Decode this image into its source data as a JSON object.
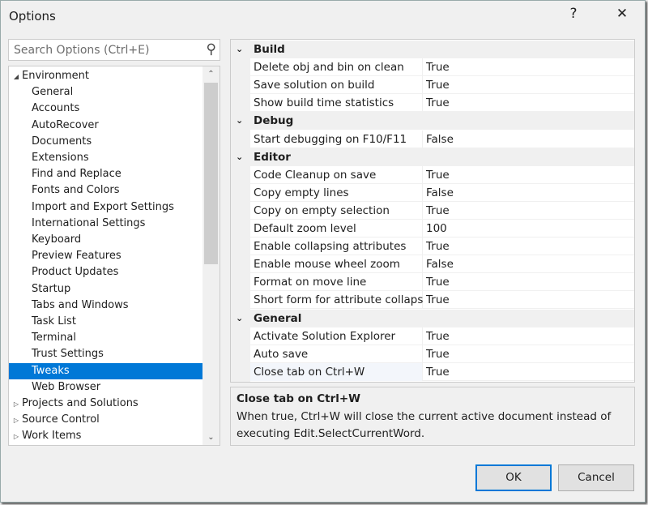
{
  "window": {
    "title": "Options",
    "help_label": "?",
    "close_label": "✕"
  },
  "search": {
    "placeholder": "Search Options (Ctrl+E)",
    "icon": "search-icon"
  },
  "tree": {
    "items": [
      {
        "label": "Environment",
        "level": 0,
        "expanded": true
      },
      {
        "label": "General",
        "level": 1
      },
      {
        "label": "Accounts",
        "level": 1
      },
      {
        "label": "AutoRecover",
        "level": 1
      },
      {
        "label": "Documents",
        "level": 1
      },
      {
        "label": "Extensions",
        "level": 1
      },
      {
        "label": "Find and Replace",
        "level": 1
      },
      {
        "label": "Fonts and Colors",
        "level": 1
      },
      {
        "label": "Import and Export Settings",
        "level": 1
      },
      {
        "label": "International Settings",
        "level": 1
      },
      {
        "label": "Keyboard",
        "level": 1
      },
      {
        "label": "Preview Features",
        "level": 1
      },
      {
        "label": "Product Updates",
        "level": 1
      },
      {
        "label": "Startup",
        "level": 1
      },
      {
        "label": "Tabs and Windows",
        "level": 1
      },
      {
        "label": "Task List",
        "level": 1
      },
      {
        "label": "Terminal",
        "level": 1
      },
      {
        "label": "Trust Settings",
        "level": 1
      },
      {
        "label": "Tweaks",
        "level": 1,
        "selected": true
      },
      {
        "label": "Web Browser",
        "level": 1
      },
      {
        "label": "Projects and Solutions",
        "level": 0,
        "expanded": false
      },
      {
        "label": "Source Control",
        "level": 0,
        "expanded": false
      },
      {
        "label": "Work Items",
        "level": 0,
        "expanded": false
      }
    ]
  },
  "grid": {
    "categories": [
      {
        "name": "Build",
        "props": [
          [
            "Delete obj and bin on clean",
            "True"
          ],
          [
            "Save solution on build",
            "True"
          ],
          [
            "Show build time statistics",
            "True"
          ]
        ]
      },
      {
        "name": "Debug",
        "props": [
          [
            "Start debugging on F10/F11",
            "False"
          ]
        ]
      },
      {
        "name": "Editor",
        "props": [
          [
            "Code Cleanup on save",
            "True"
          ],
          [
            "Copy empty lines",
            "False"
          ],
          [
            "Copy on empty selection",
            "True"
          ],
          [
            "Default zoom level",
            "100"
          ],
          [
            "Enable collapsing attributes",
            "True"
          ],
          [
            "Enable mouse wheel zoom",
            "False"
          ],
          [
            "Format on move line",
            "True"
          ],
          [
            "Short form for attribute collaps",
            "True"
          ]
        ]
      },
      {
        "name": "General",
        "props": [
          [
            "Activate Solution Explorer",
            "True"
          ],
          [
            "Auto save",
            "True"
          ],
          [
            "Close tab on Ctrl+W",
            "True"
          ]
        ]
      }
    ],
    "selected": "Close tab on Ctrl+W"
  },
  "description": {
    "title": "Close tab on Ctrl+W",
    "text": "When true, Ctrl+W will close the current active document instead of executing Edit.SelectCurrentWord."
  },
  "buttons": {
    "ok": "OK",
    "cancel": "Cancel"
  },
  "colors": {
    "accent": "#0078d7"
  }
}
